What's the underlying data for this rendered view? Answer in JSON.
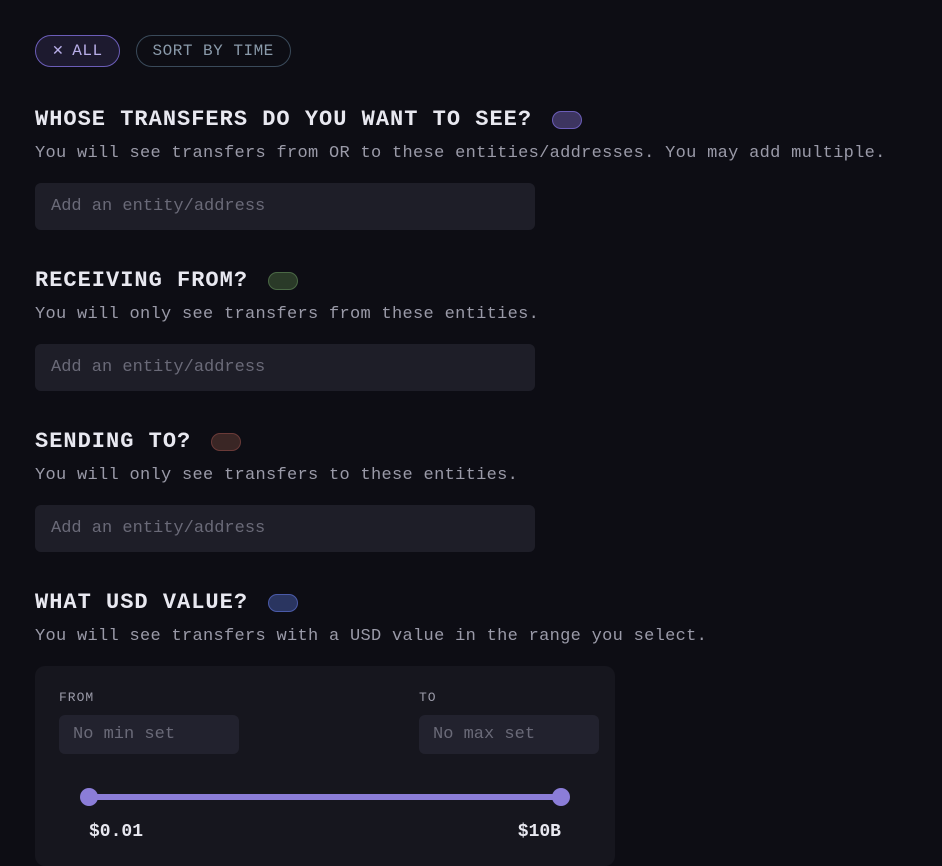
{
  "filterBar": {
    "allLabel": "ALL",
    "sortLabel": "SORT BY TIME"
  },
  "sections": {
    "whose": {
      "title": "WHOSE TRANSFERS DO YOU WANT TO SEE?",
      "desc": "You will see transfers from OR to these entities/addresses. You may add multiple.",
      "placeholder": "Add an entity/address"
    },
    "receiving": {
      "title": "RECEIVING FROM?",
      "desc": "You will only see transfers from these entities.",
      "placeholder": "Add an entity/address"
    },
    "sending": {
      "title": "SENDING TO?",
      "desc": "You will only see transfers to these entities.",
      "placeholder": "Add an entity/address"
    },
    "usd": {
      "title": "WHAT USD VALUE?",
      "desc": "You will see transfers with a USD value in the range you select.",
      "fromLabel": "FROM",
      "toLabel": "TO",
      "fromPlaceholder": "No min set",
      "toPlaceholder": "No max set",
      "minDisplay": "$0.01",
      "maxDisplay": "$10B"
    }
  }
}
